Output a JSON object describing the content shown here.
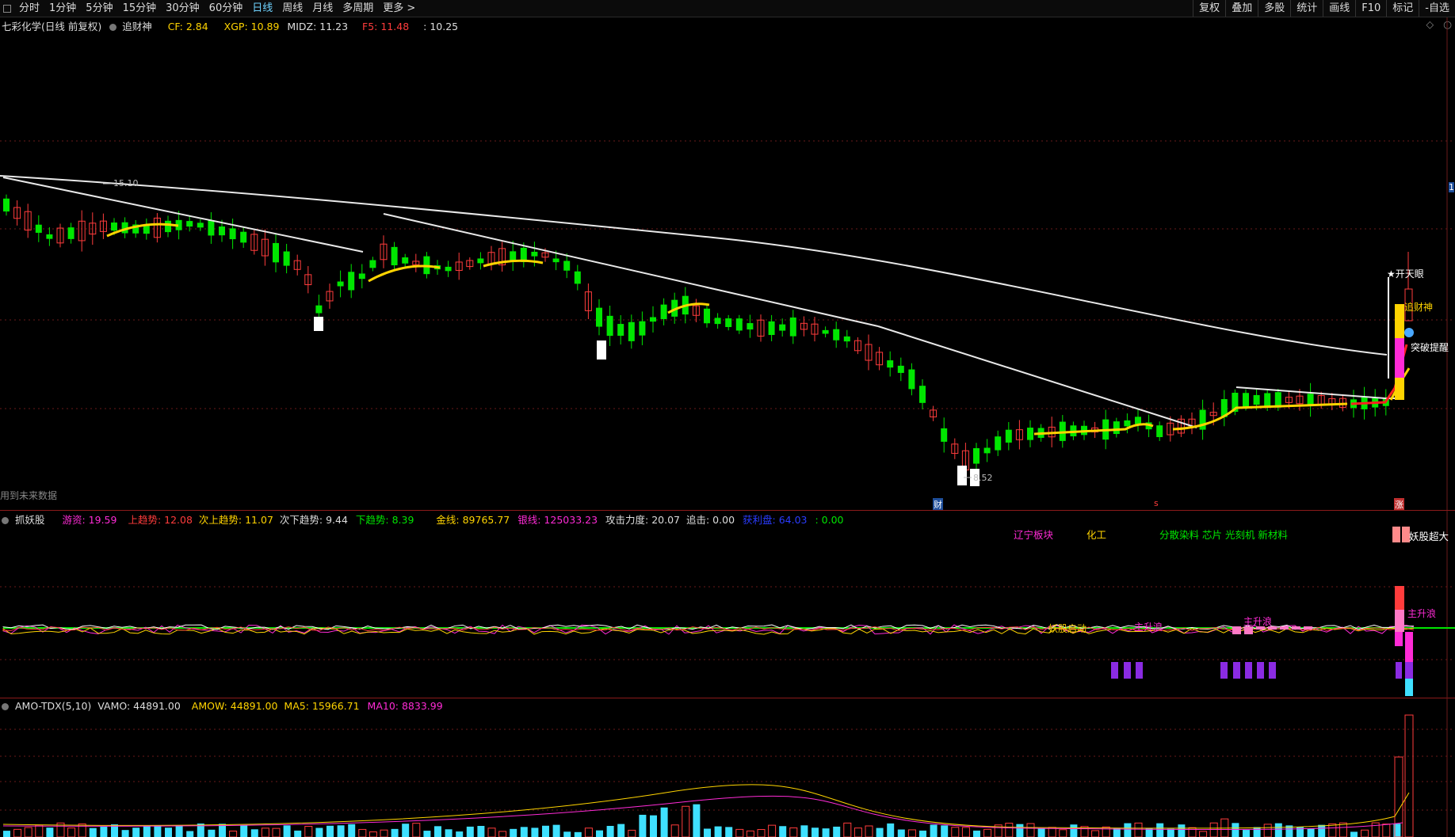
{
  "toolbar": {
    "left": [
      "分时",
      "1分钟",
      "5分钟",
      "15分钟",
      "30分钟",
      "60分钟",
      "日线",
      "周线",
      "月线",
      "多周期",
      "更多 >"
    ],
    "active": "日线",
    "right": [
      "复权",
      "叠加",
      "多股",
      "统计",
      "画线",
      "F10",
      "标记",
      "-自选"
    ]
  },
  "main_header": {
    "title": "七彩化学(日线 前复权)",
    "indicator": "追财神",
    "cf": "CF: 2.84",
    "xgp": "XGP: 10.89",
    "midz": "MIDZ: 11.23",
    "f5": "F5: 11.48",
    "last": ": 10.25"
  },
  "main_labels": {
    "high_price": "15.10",
    "low_price": "8.52",
    "future_note": "用到未来数据",
    "kaitianyan": "★开天眼",
    "zhuicaishen": "追财神",
    "tupo": "突破提醒",
    "marker_cai": "财",
    "marker_s": "s",
    "marker_zhang": "涨",
    "right_edge": "1"
  },
  "ind_header": {
    "name": "抓妖股",
    "youzi": "游资: 19.59",
    "shang": "上趋势: 12.08",
    "cishang": "次上趋势: 11.07",
    "cixia": "次下趋势: 9.44",
    "xia": "下趋势: 8.39",
    "jin": "金线: 89765.77",
    "yin": "银线: 125033.23",
    "gongji": "攻击力度: 20.07",
    "zhuiji": "追击: 0.00",
    "huodong": "获利盘: 64.03",
    "zero": ": 0.00"
  },
  "ind_labels": {
    "sector1": "辽宁板块",
    "sector2": "化工",
    "sector3": "分散染料 芯片 光刻机 新材料",
    "yaogu_chaoda": "妖股超大",
    "yaogu_qidong": "妖股启动",
    "zhushenglang1": "主升浪",
    "zhushenglang2": "主升浪",
    "zhushenglang3": "主升浪"
  },
  "vol_header": {
    "name": "AMO-TDX(5,10)",
    "vamo": "VAMO: 44891.00",
    "amow": "AMOW: 44891.00",
    "ma5": "MA5: 15966.71",
    "ma10": "MA10: 8833.99"
  },
  "colors": {
    "up": "#ff3c3c",
    "down": "#00e600",
    "yellow": "#ffd400",
    "magenta": "#ff2bd6",
    "cyan": "#3fe0ff",
    "white": "#ffffff",
    "purple": "#8a2be2"
  }
}
